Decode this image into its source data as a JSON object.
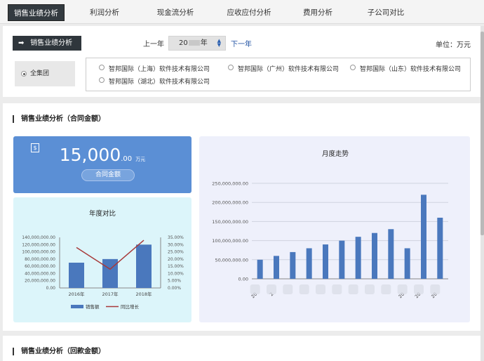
{
  "tabs": [
    {
      "label": "销售业绩分析",
      "active": true
    },
    {
      "label": "利润分析"
    },
    {
      "label": "现金流分析"
    },
    {
      "label": "应收应付分析"
    },
    {
      "label": "费用分析"
    },
    {
      "label": "子公司对比"
    }
  ],
  "filter": {
    "section_button": "销售业绩分析",
    "prev_year": "上一年",
    "year_prefix": "20",
    "year_suffix": "年",
    "next_year": "下一年",
    "unit": "单位：万元",
    "all_group": "全集团",
    "companies": [
      "智邦国际（上海）软件技术有限公司",
      "智邦国际（广州）软件技术有限公司",
      "智邦国际（山东）软件技术有限公司",
      "智邦国际（湖北）软件技术有限公司"
    ]
  },
  "contract_section": {
    "title": "销售业绩分析（合同金额）",
    "kpi": {
      "value_int": "15,000",
      "value_dec": ".00",
      "unit": "万元",
      "label": "合同金额"
    }
  },
  "payment_section": {
    "title": "销售业绩分析（回款金额）"
  },
  "colors": {
    "bar": "#4a78bd",
    "line": "#a83a3a",
    "kpi_bg": "#5b8fd5"
  },
  "chart_data": [
    {
      "type": "bar",
      "title": "年度对比",
      "categories": [
        "2016年",
        "2017年",
        "2018年"
      ],
      "series": [
        {
          "name": "销售额",
          "type": "bar",
          "axis": "left",
          "values": [
            70000000,
            80000000,
            120000000
          ]
        },
        {
          "name": "同比增长",
          "type": "line",
          "axis": "right",
          "values": [
            28,
            13,
            33
          ]
        }
      ],
      "ylim": [
        0,
        140000000
      ],
      "y_ticks": [
        "0.00",
        "20,000,000.00",
        "40,000,000.00",
        "60,000,000.00",
        "80,000,000.00",
        "100,000,000.00",
        "120,000,000.00",
        "140,000,000.00"
      ],
      "y2lim": [
        0,
        35
      ],
      "y2_ticks": [
        "0.00%",
        "5.00%",
        "10.00%",
        "15.00%",
        "20.00%",
        "25.00%",
        "30.00%",
        "35.00%"
      ],
      "legend": "bottom"
    },
    {
      "type": "bar",
      "title": "月度走势",
      "categories": [
        "20__年1月",
        "20__年2月",
        "20__年3月",
        "20__年4月",
        "20__年5月",
        "20__年6月",
        "20__年7月",
        "20__年8月",
        "20__年9月",
        "20__年10月",
        "20__年11月",
        "20__年12月"
      ],
      "category_labels_visible": [
        "20",
        "2",
        "",
        "",
        "",
        "",
        "",
        "",
        "",
        "20",
        "20",
        "20"
      ],
      "values": [
        50000000,
        60000000,
        70000000,
        80000000,
        90000000,
        100000000,
        110000000,
        120000000,
        130000000,
        80000000,
        220000000,
        160000000
      ],
      "ylim": [
        0,
        250000000
      ],
      "y_ticks": [
        "0.00",
        "50,000,000.00",
        "100,000,000.00",
        "150,000,000.00",
        "200,000,000.00",
        "250,000,000.00"
      ],
      "grid": true
    }
  ]
}
